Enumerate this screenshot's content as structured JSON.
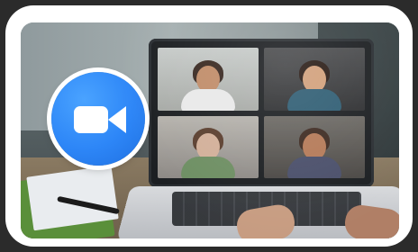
{
  "image": {
    "elements": [
      {
        "name": "zoom-logo",
        "icon": "video-camera-icon"
      },
      {
        "name": "laptop",
        "screen": "video-call-grid"
      },
      {
        "name": "participants-grid",
        "tiles": 4
      },
      {
        "name": "desk-items",
        "items": [
          "notebook",
          "pen"
        ]
      },
      {
        "name": "hands",
        "count": 2
      }
    ]
  }
}
